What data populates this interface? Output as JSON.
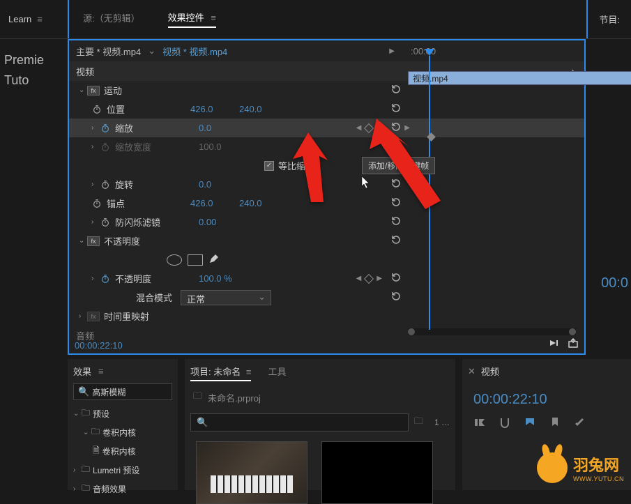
{
  "topbar": {
    "learn": "Learn",
    "source_tab": "源:（无剪辑）",
    "effect_tab": "效果控件",
    "program_tab": "节目:"
  },
  "left": {
    "line1": "Premie",
    "line2": "Tuto"
  },
  "clip": {
    "primary": "主要 * 视频.mp4",
    "secondary": "视频 * 视频.mp4",
    "timecode_hdr": ":00:00",
    "bar_label": "视频.mp4"
  },
  "sections": {
    "video": "视频",
    "audio": "音频"
  },
  "motion": {
    "title": "运动",
    "position": "位置",
    "pos_x": "426.0",
    "pos_y": "240.0",
    "scale": "缩放",
    "scale_val": "0.0",
    "scale_w": "缩放宽度",
    "scale_w_val": "100.0",
    "uniform": "等比缩放",
    "rotation": "旋转",
    "rotation_val": "0.0",
    "anchor": "锚点",
    "anchor_x": "426.0",
    "anchor_y": "240.0",
    "flicker": "防闪烁滤镜",
    "flicker_val": "0.00"
  },
  "opacity": {
    "title": "不透明度",
    "label": "不透明度",
    "val": "100.0 %",
    "blend_label": "混合模式",
    "blend_val": "正常"
  },
  "timeremap": {
    "title": "时间重映射"
  },
  "tooltip": "添加/移除关键帧",
  "timecode": "00:00:22:10",
  "effects": {
    "title": "效果",
    "search": "高斯模糊",
    "preset": "预设",
    "conv": "卷积内核",
    "conv2": "卷积内核",
    "lumetri": "Lumetri 预设",
    "audio_fx": "音频效果"
  },
  "project": {
    "title": "项目: 未命名",
    "tools": "工具",
    "file": "未命名.prproj",
    "count": "1 …"
  },
  "preview": {
    "title": "视频",
    "tc": "00:00:22:10"
  },
  "program_tc": "00:0",
  "logo": {
    "text": "羽兔网",
    "url": "WWW.YUTU.CN"
  }
}
